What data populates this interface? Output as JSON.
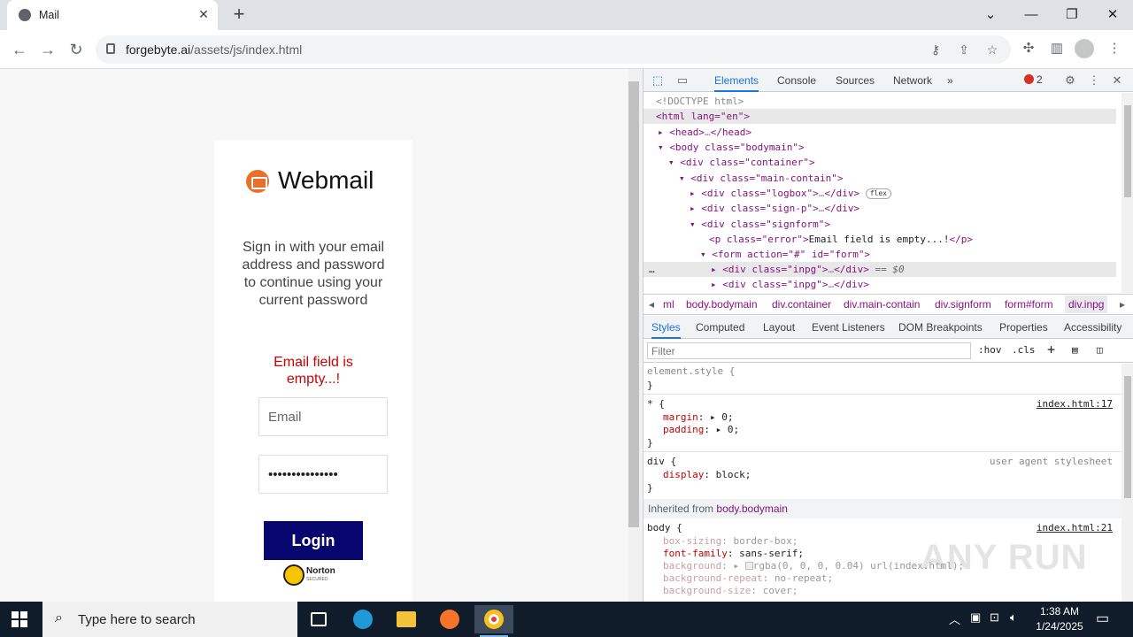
{
  "browser": {
    "tab_title": "Mail",
    "tab_close": "✕",
    "new_tab": "+",
    "url_host": "forgebyte.ai",
    "url_path": "/assets/js/index.html"
  },
  "page": {
    "logo_text": "Webmail",
    "sign_prompt": "Sign in with your email address and password to continue using your current password",
    "error": "Email field is empty...!",
    "email_placeholder": "Email",
    "password_value": "•••••••••••••••",
    "login_label": "Login",
    "norton_title": "Norton",
    "norton_sub": "SECURED"
  },
  "devtools": {
    "tabs": [
      "Elements",
      "Console",
      "Sources",
      "Network",
      "»"
    ],
    "error_count": "2",
    "breadcrumbs": [
      "ml",
      "body.bodymain",
      "div.container",
      "div.main-contain",
      "div.signform",
      "form#form",
      "div.inpg"
    ],
    "style_tabs": [
      "Styles",
      "Computed",
      "Layout",
      "Event Listeners",
      "DOM Breakpoints",
      "Properties",
      "Accessibility"
    ],
    "filter_placeholder": "Filter",
    "hov": ":hov",
    "cls": ".cls",
    "dom": {
      "doctype": "<!DOCTYPE html>",
      "l1": "<html lang=\"en\">",
      "l2a": "<head>",
      "l2b": "</head>",
      "l3": "<body class=\"bodymain\">",
      "l4": "<div class=\"container\">",
      "l5": "<div class=\"main-contain\">",
      "l6a": "<div class=\"logbox\">",
      "l6b": "</div>",
      "flex": "flex",
      "l7a": "<div class=\"sign-p\">",
      "l7b": "</div>",
      "l8": "<div class=\"signform\">",
      "l9a": "<p class=\"error\">",
      "l9t": "Email field is empty...!",
      "l9b": "</p>",
      "l10": "<form action=\"#\" id=\"form\">",
      "l11a": "<div class=\"inpg\">",
      "l11b": "</div>",
      "l11c": "== $0",
      "l12a": "<div class=\"inpg\">",
      "l12b": "</div>"
    },
    "styles": {
      "element_style": "element.style {",
      "close": "}",
      "star_sel": "* {",
      "star_src": "index.html:17",
      "margin": "margin",
      "margin_val": "0;",
      "padding": "padding",
      "padding_val": "0;",
      "div_sel": "div {",
      "ua": "user agent stylesheet",
      "display": "display",
      "display_val": "block;",
      "inherited_label": "Inherited from",
      "inherited_sel": "body.bodymain",
      "body_sel": "body {",
      "body_src": "index.html:21",
      "box_sizing": "box-sizing",
      "box_sizing_val": "border-box;",
      "font_family": "font-family",
      "font_family_val": "sans-serif;",
      "background": "background",
      "background_val": "rgba(0, 0, 0, 0.04) url(index.html);",
      "bg_repeat": "background-repeat",
      "bg_repeat_val": "no-repeat;",
      "bg_size": "background-size",
      "bg_size_val": "cover;"
    }
  },
  "watermark": "ANY RUN",
  "taskbar": {
    "search_placeholder": "Type here to search",
    "time": "1:38 AM",
    "date": "1/24/2025"
  },
  "colors": {
    "login_bg": "#06066e",
    "error": "#cc0000",
    "devtools_accent": "#1a73e8"
  }
}
